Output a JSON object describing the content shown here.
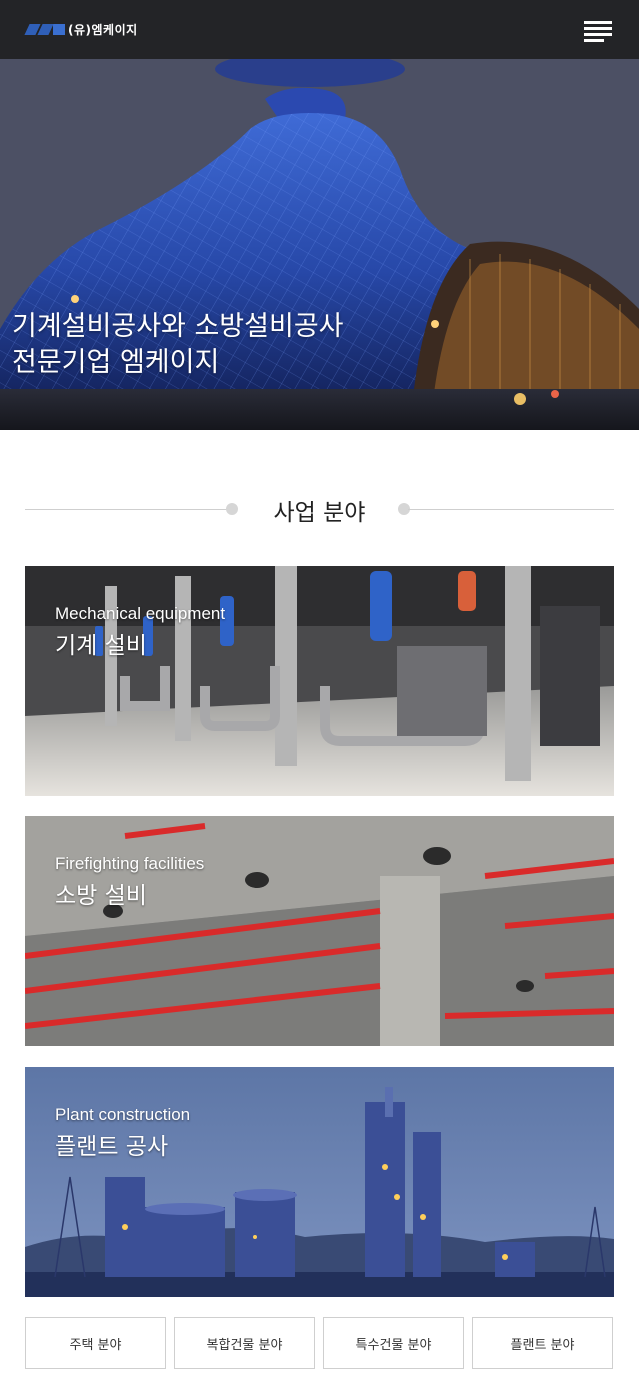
{
  "header": {
    "logo_mark": "MK",
    "logo_text": "(유)엠케이지",
    "menu_icon": "hamburger-menu-icon"
  },
  "hero": {
    "line1": "기계설비공사와 소방설비공사",
    "line2": "전문기업 엠케이지"
  },
  "section": {
    "title": "사업 분야"
  },
  "cards": [
    {
      "en": "Mechanical equipment",
      "ko": "기계 설비"
    },
    {
      "en": "Firefighting facilities",
      "ko": "소방 설비"
    },
    {
      "en": "Plant construction",
      "ko": "플랜트 공사"
    }
  ],
  "tabs": [
    "주택 분야",
    "복합건물 분야",
    "특수건물 분야",
    "플랜트 분야"
  ]
}
